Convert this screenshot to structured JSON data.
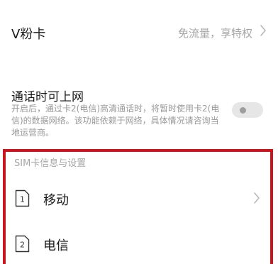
{
  "vcard": {
    "title": "V粉卡",
    "subtitle": "免流量，享特权",
    "chevron_icon": "chevron-right-icon"
  },
  "wifi_calling": {
    "title": "通话时可上网",
    "description": "开启后，通过卡2(电信)高清通话时，将暂时使用卡2(电信)的数据网络。该功能依赖于网络，具体情况请咨询当地运营商。",
    "toggle_state": "off"
  },
  "sim_section": {
    "header": "SIM卡信息与设置",
    "items": [
      {
        "slot": "1",
        "label": "移动",
        "icon": "sim-card-icon"
      },
      {
        "slot": "2",
        "label": "电信",
        "icon": "sim-card-icon"
      }
    ]
  },
  "colors": {
    "highlight_border": "#c7161e",
    "secondary_text": "#a6a6a6"
  }
}
